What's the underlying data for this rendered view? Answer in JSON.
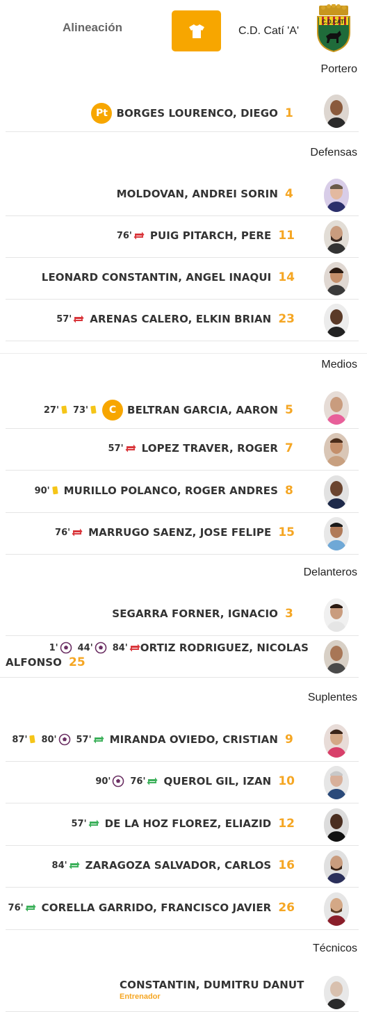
{
  "header": {
    "title": "Alineación",
    "team_name": "C.D. Catí 'A'",
    "crest_text": "C.D.CATÍ",
    "shirt_icon": "shirt-icon"
  },
  "sections": {
    "portero": "Portero",
    "defensas": "Defensas",
    "medios": "Medios",
    "delanteros": "Delanteros",
    "suplentes": "Suplentes",
    "tecnicos": "Técnicos"
  },
  "players": [
    {
      "name": "BORGES LOURENCO, DIEGO",
      "number": "1",
      "badge": "Pt",
      "events": []
    },
    {
      "name": "MOLDOVAN, ANDREI SORIN",
      "number": "4",
      "events": []
    },
    {
      "name": "PUIG PITARCH, PERE",
      "number": "11",
      "events": [
        {
          "minute": "76'",
          "type": "sub-out-icon"
        }
      ]
    },
    {
      "name": "LEONARD CONSTANTIN, ANGEL INAQUI",
      "number": "14",
      "events": []
    },
    {
      "name": "ARENAS CALERO, ELKIN BRIAN",
      "number": "23",
      "events": [
        {
          "minute": "57'",
          "type": "sub-out-icon"
        }
      ]
    },
    {
      "name": "BELTRAN GARCIA, AARON",
      "number": "5",
      "badge": "C",
      "events": [
        {
          "minute": "27'",
          "type": "yellow-card-icon"
        },
        {
          "minute": "73'",
          "type": "yellow-card-icon"
        }
      ]
    },
    {
      "name": "LOPEZ TRAVER, ROGER",
      "number": "7",
      "events": [
        {
          "minute": "57'",
          "type": "sub-out-icon"
        }
      ]
    },
    {
      "name": "MURILLO POLANCO, ROGER ANDRES",
      "number": "8",
      "events": [
        {
          "minute": "90'",
          "type": "yellow-card-icon"
        }
      ]
    },
    {
      "name": "MARRUGO SAENZ, JOSE FELIPE",
      "number": "15",
      "events": [
        {
          "minute": "76'",
          "type": "sub-out-icon"
        }
      ]
    },
    {
      "name": "SEGARRA FORNER, IGNACIO",
      "number": "3",
      "events": []
    },
    {
      "name_line1": "ORTIZ RODRIGUEZ, NICOLAS",
      "name_line2": "ALFONSO",
      "number": "25",
      "events": [
        {
          "minute": "1'",
          "type": "goal-icon"
        },
        {
          "minute": "44'",
          "type": "goal-icon"
        },
        {
          "minute": "84'",
          "type": "sub-out-icon"
        }
      ]
    },
    {
      "name": "MIRANDA OVIEDO, CRISTIAN",
      "number": "9",
      "events": [
        {
          "minute": "87'",
          "type": "yellow-card-icon"
        },
        {
          "minute": "80'",
          "type": "goal-icon"
        },
        {
          "minute": "57'",
          "type": "sub-in-icon"
        }
      ]
    },
    {
      "name": "QUEROL GIL, IZAN",
      "number": "10",
      "events": [
        {
          "minute": "90'",
          "type": "goal-icon"
        },
        {
          "minute": "76'",
          "type": "sub-in-icon"
        }
      ]
    },
    {
      "name": "DE LA HOZ FLOREZ, ELIAZID",
      "number": "12",
      "events": [
        {
          "minute": "57'",
          "type": "sub-in-icon"
        }
      ]
    },
    {
      "name": "ZARAGOZA SALVADOR, CARLOS",
      "number": "16",
      "events": [
        {
          "minute": "84'",
          "type": "sub-in-icon"
        }
      ]
    },
    {
      "name": "CORELLA GARRIDO, FRANCISCO JAVIER",
      "number": "26",
      "events": [
        {
          "minute": "76'",
          "type": "sub-in-icon"
        }
      ]
    }
  ],
  "coach": {
    "name": "CONSTANTIN, DUMITRU DANUT",
    "role": "Entrenador"
  },
  "colors": {
    "accent": "#f7a600",
    "number": "#f5a623",
    "sub_out": "#d9353a",
    "sub_in": "#3cb05a",
    "yellow_card": "#f5c518",
    "goal": "#6b2f63"
  }
}
